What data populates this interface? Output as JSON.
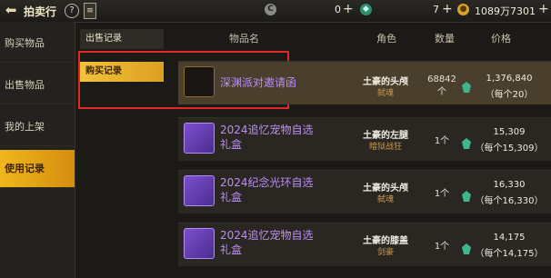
{
  "header": {
    "title": "拍卖行",
    "help": "?",
    "currency1_value": "0",
    "currency2_value": "7",
    "gold_value": "1089万7301"
  },
  "sidebar": {
    "items": [
      {
        "label": "购买物品"
      },
      {
        "label": "出售物品"
      },
      {
        "label": "我的上架"
      },
      {
        "label": "使用记录"
      }
    ]
  },
  "submenu": {
    "items": [
      {
        "label": "出售记录"
      },
      {
        "label": "购买记录"
      }
    ]
  },
  "table": {
    "headers": {
      "name": "物品名",
      "role": "角色",
      "qty": "数量",
      "price": "价格"
    },
    "rows": [
      {
        "name": "深渊派对邀请函",
        "role_name": "土豪的头颅",
        "role_class": "弑魂",
        "qty": "68842",
        "qty_unit": "个",
        "price": "1,376,840",
        "unit_price": "（每个20）"
      },
      {
        "name": "2024追忆宠物自选礼盒",
        "role_name": "土豪的左腿",
        "role_class": "暗狱战狂",
        "qty": "1个",
        "qty_unit": "",
        "price": "15,309",
        "unit_price": "（每个15,309）"
      },
      {
        "name": "2024纪念光环自选礼盒",
        "role_name": "土豪的头颅",
        "role_class": "弑魂",
        "qty": "1个",
        "qty_unit": "",
        "price": "16,330",
        "unit_price": "（每个16,330）"
      },
      {
        "name": "2024追忆宠物自选礼盒",
        "role_name": "土豪的膝盖",
        "role_class": "剑豪",
        "qty": "1个",
        "qty_unit": "",
        "price": "14,175",
        "unit_price": "（每个14,175）"
      }
    ]
  },
  "colors": {
    "accent": "#f0b71d",
    "highlight": "#e0282a",
    "item_name": "#bb8ff5"
  }
}
